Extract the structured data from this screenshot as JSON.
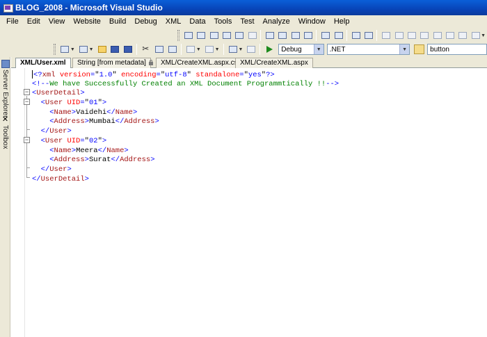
{
  "window": {
    "title": "BLOG_2008 - Microsoft Visual Studio"
  },
  "menu": [
    "File",
    "Edit",
    "View",
    "Website",
    "Build",
    "Debug",
    "XML",
    "Data",
    "Tools",
    "Test",
    "Analyze",
    "Window",
    "Help"
  ],
  "toolbar": {
    "configuration": "Debug",
    "platform": ".NET",
    "find_text": "button"
  },
  "dock": {
    "server_explorer": "Server Explorer",
    "toolbox": "Toolbox"
  },
  "tabs": [
    {
      "label": "XML/User.xml",
      "active": true
    },
    {
      "label": "String [from metadata]",
      "active": false
    },
    {
      "label": "XML/CreateXML.aspx.cs",
      "active": false
    },
    {
      "label": "XML/CreateXML.aspx",
      "active": false
    }
  ],
  "code_lines": [
    [
      {
        "c": "blue",
        "t": "<?"
      },
      {
        "c": "maroon",
        "t": "xml"
      },
      {
        "c": "red",
        "t": " version"
      },
      {
        "c": "blue",
        "t": "="
      },
      {
        "c": "",
        "t": "\""
      },
      {
        "c": "blue",
        "t": "1.0"
      },
      {
        "c": "",
        "t": "\""
      },
      {
        "c": "red",
        "t": " encoding"
      },
      {
        "c": "blue",
        "t": "="
      },
      {
        "c": "",
        "t": "\""
      },
      {
        "c": "blue",
        "t": "utf-8"
      },
      {
        "c": "",
        "t": "\""
      },
      {
        "c": "red",
        "t": " standalone"
      },
      {
        "c": "blue",
        "t": "="
      },
      {
        "c": "",
        "t": "\""
      },
      {
        "c": "blue",
        "t": "yes"
      },
      {
        "c": "",
        "t": "\""
      },
      {
        "c": "blue",
        "t": "?>"
      }
    ],
    [
      {
        "c": "blue",
        "t": "<!--"
      },
      {
        "c": "green",
        "t": "We have Successfully Created an XML Document Programmtically !!"
      },
      {
        "c": "blue",
        "t": "-->"
      }
    ],
    [
      {
        "c": "blue",
        "t": "<"
      },
      {
        "c": "maroon",
        "t": "UserDetail"
      },
      {
        "c": "blue",
        "t": ">"
      }
    ],
    [
      {
        "c": "",
        "t": "  "
      },
      {
        "c": "blue",
        "t": "<"
      },
      {
        "c": "maroon",
        "t": "User"
      },
      {
        "c": "red",
        "t": " UID"
      },
      {
        "c": "blue",
        "t": "="
      },
      {
        "c": "",
        "t": "\""
      },
      {
        "c": "blue",
        "t": "01"
      },
      {
        "c": "",
        "t": "\""
      },
      {
        "c": "blue",
        "t": ">"
      }
    ],
    [
      {
        "c": "",
        "t": "    "
      },
      {
        "c": "blue",
        "t": "<"
      },
      {
        "c": "maroon",
        "t": "Name"
      },
      {
        "c": "blue",
        "t": ">"
      },
      {
        "c": "",
        "t": "Vaidehi"
      },
      {
        "c": "blue",
        "t": "</"
      },
      {
        "c": "maroon",
        "t": "Name"
      },
      {
        "c": "blue",
        "t": ">"
      }
    ],
    [
      {
        "c": "",
        "t": "    "
      },
      {
        "c": "blue",
        "t": "<"
      },
      {
        "c": "maroon",
        "t": "Address"
      },
      {
        "c": "blue",
        "t": ">"
      },
      {
        "c": "",
        "t": "Mumbai"
      },
      {
        "c": "blue",
        "t": "</"
      },
      {
        "c": "maroon",
        "t": "Address"
      },
      {
        "c": "blue",
        "t": ">"
      }
    ],
    [
      {
        "c": "",
        "t": "  "
      },
      {
        "c": "blue",
        "t": "</"
      },
      {
        "c": "maroon",
        "t": "User"
      },
      {
        "c": "blue",
        "t": ">"
      }
    ],
    [
      {
        "c": "",
        "t": "  "
      },
      {
        "c": "blue",
        "t": "<"
      },
      {
        "c": "maroon",
        "t": "User"
      },
      {
        "c": "red",
        "t": " UID"
      },
      {
        "c": "blue",
        "t": "="
      },
      {
        "c": "",
        "t": "\""
      },
      {
        "c": "blue",
        "t": "02"
      },
      {
        "c": "",
        "t": "\""
      },
      {
        "c": "blue",
        "t": ">"
      }
    ],
    [
      {
        "c": "",
        "t": "    "
      },
      {
        "c": "blue",
        "t": "<"
      },
      {
        "c": "maroon",
        "t": "Name"
      },
      {
        "c": "blue",
        "t": ">"
      },
      {
        "c": "",
        "t": "Meera"
      },
      {
        "c": "blue",
        "t": "</"
      },
      {
        "c": "maroon",
        "t": "Name"
      },
      {
        "c": "blue",
        "t": ">"
      }
    ],
    [
      {
        "c": "",
        "t": "    "
      },
      {
        "c": "blue",
        "t": "<"
      },
      {
        "c": "maroon",
        "t": "Address"
      },
      {
        "c": "blue",
        "t": ">"
      },
      {
        "c": "",
        "t": "Surat"
      },
      {
        "c": "blue",
        "t": "</"
      },
      {
        "c": "maroon",
        "t": "Address"
      },
      {
        "c": "blue",
        "t": ">"
      }
    ],
    [
      {
        "c": "",
        "t": "  "
      },
      {
        "c": "blue",
        "t": "</"
      },
      {
        "c": "maroon",
        "t": "User"
      },
      {
        "c": "blue",
        "t": ">"
      }
    ],
    [
      {
        "c": "blue",
        "t": "</"
      },
      {
        "c": "maroon",
        "t": "UserDetail"
      },
      {
        "c": "blue",
        "t": ">"
      }
    ]
  ],
  "colors": {
    "title_bar": "#0a5fd8",
    "xml_delimiter": "#0000ff",
    "xml_tag": "#a31515",
    "xml_attribute": "#ff0000",
    "xml_comment": "#008000"
  }
}
